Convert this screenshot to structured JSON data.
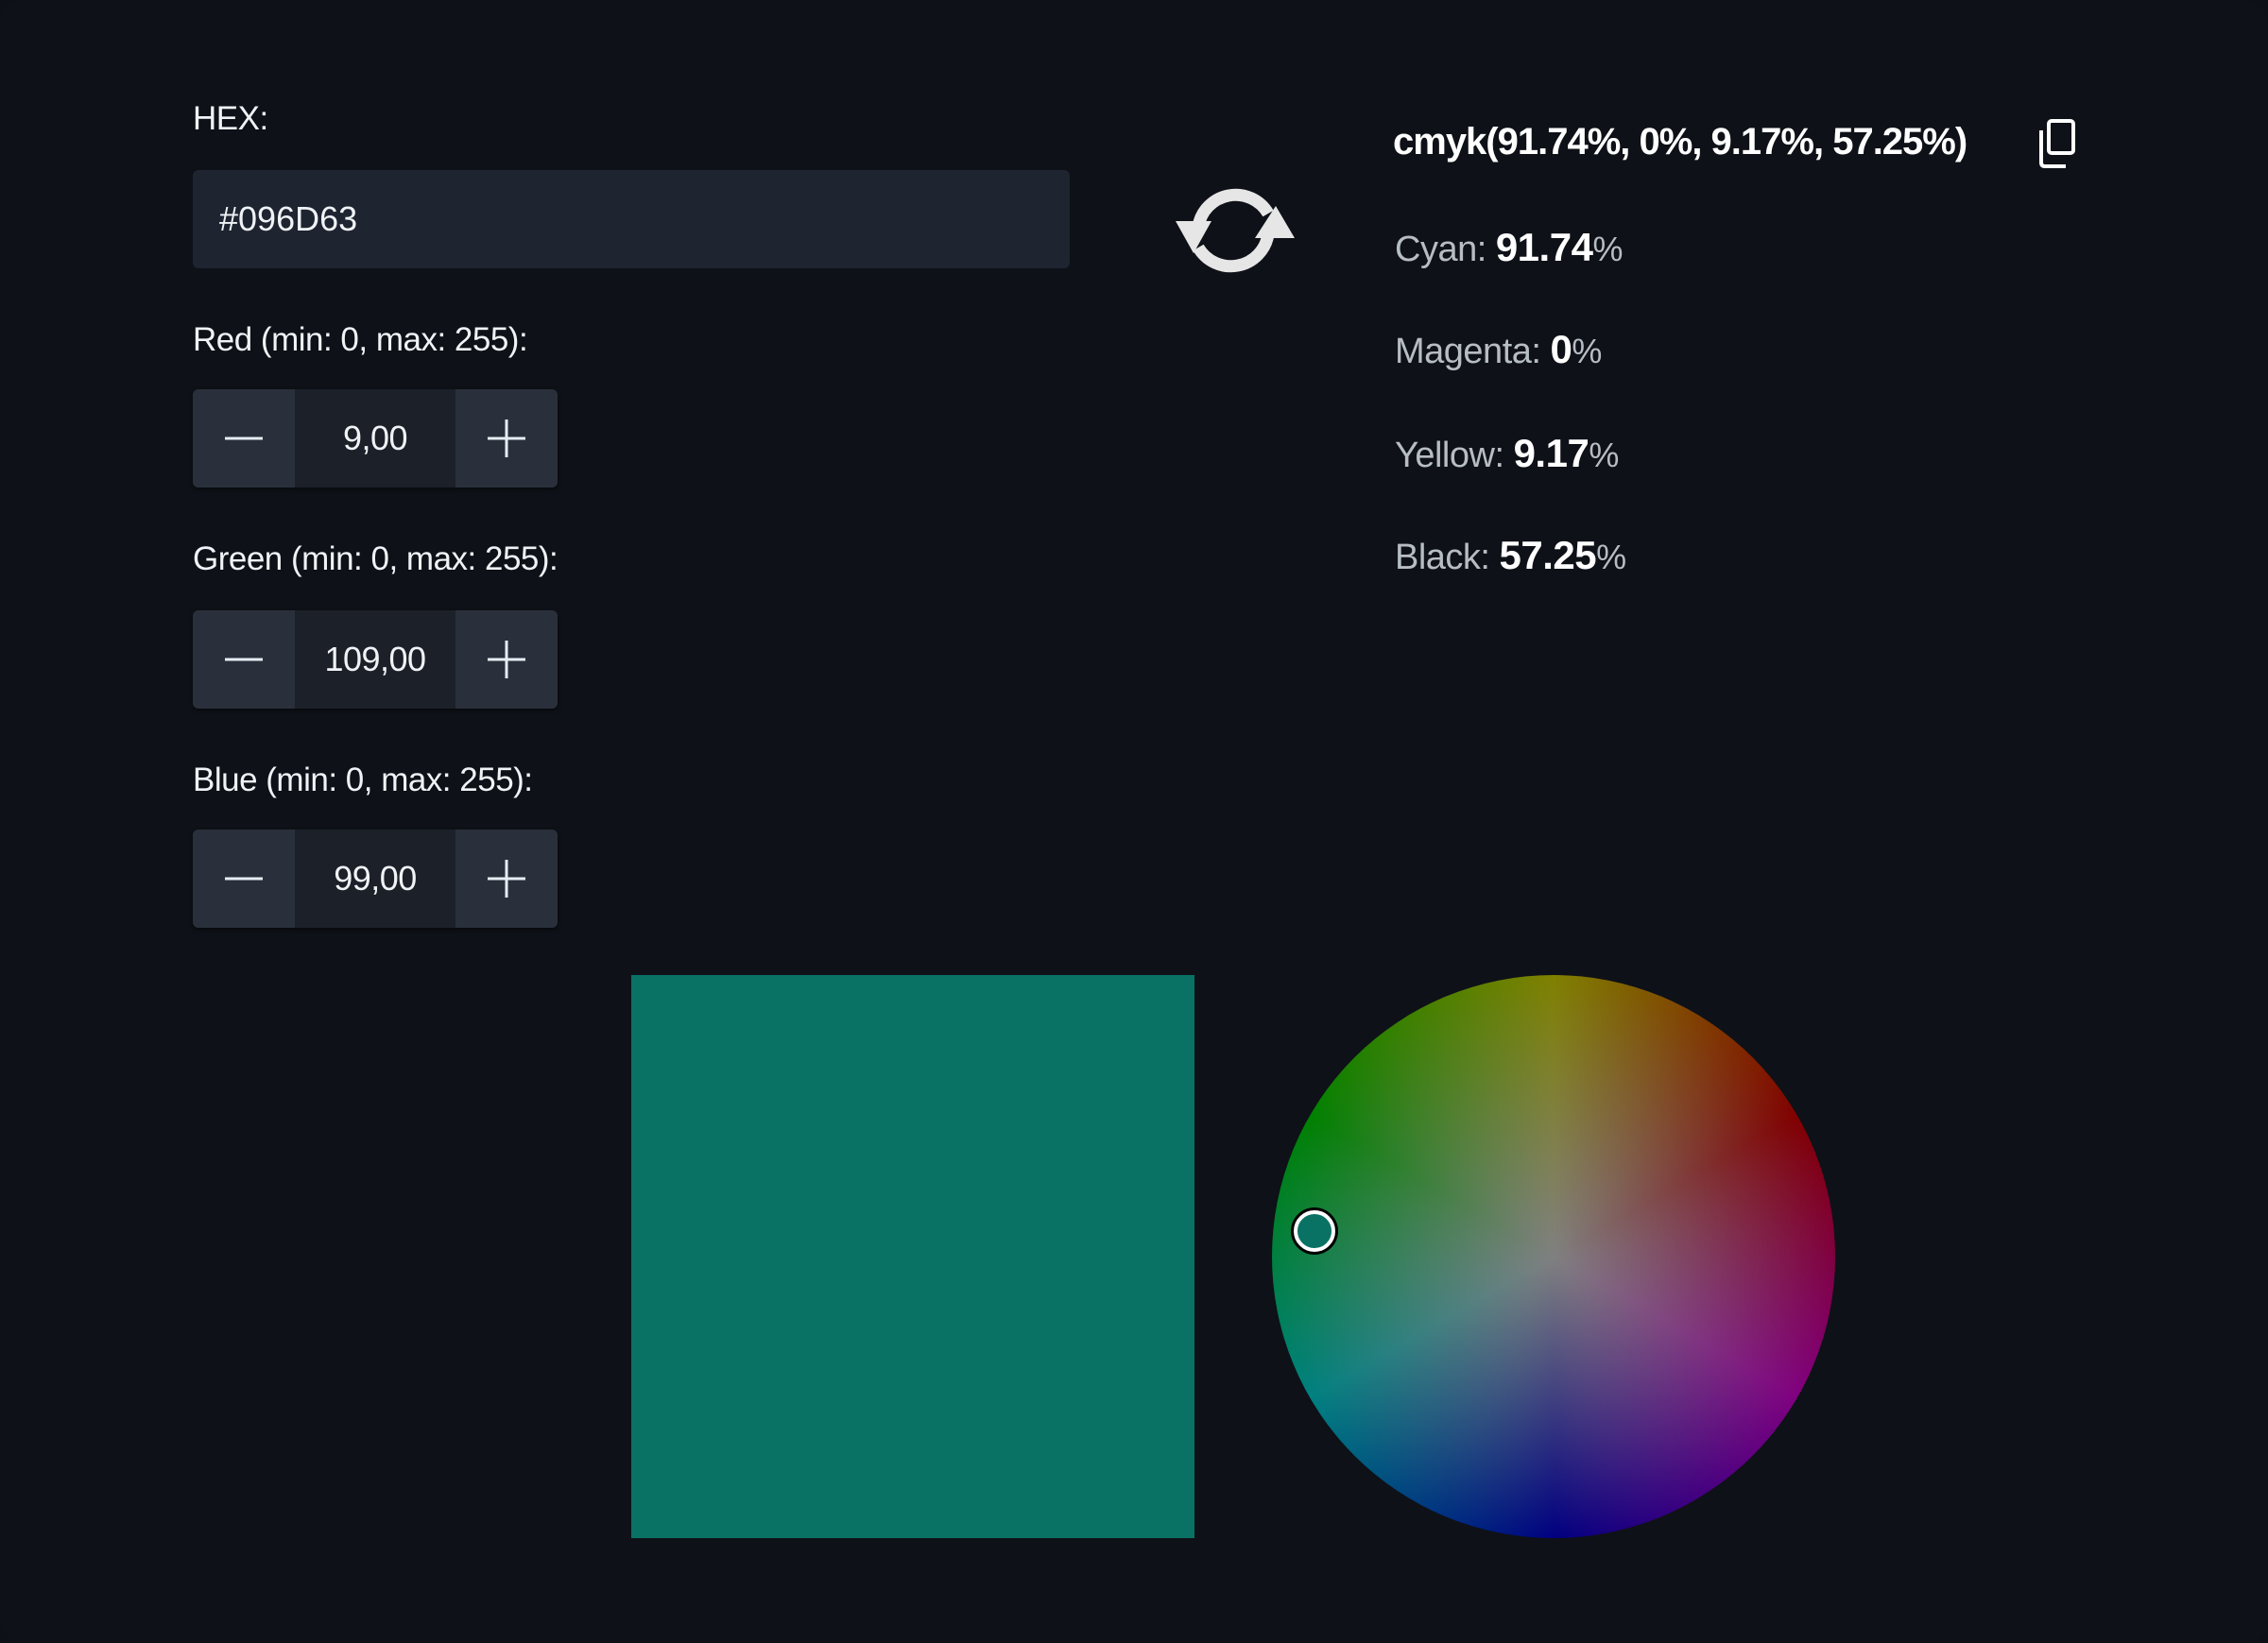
{
  "hex": {
    "label": "HEX:",
    "value": "#096D63"
  },
  "rgb": {
    "red": {
      "label": "Red (min: 0, max: 255):",
      "value": "9,00"
    },
    "green": {
      "label": "Green (min: 0, max: 255):",
      "value": "109,00"
    },
    "blue": {
      "label": "Blue (min: 0, max: 255):",
      "value": "99,00"
    }
  },
  "icons": {
    "sync": "sync-arrows-icon",
    "copy": "copy-icon",
    "minus": "minus-icon",
    "plus": "plus-icon"
  },
  "cmyk": {
    "string": "cmyk(91.74%, 0%, 9.17%, 57.25%)",
    "cyan": {
      "label": "Cyan: ",
      "value": "91.74",
      "unit": "%"
    },
    "magenta": {
      "label": "Magenta: ",
      "value": "0",
      "unit": "%"
    },
    "yellow": {
      "label": "Yellow: ",
      "value": "9.17",
      "unit": "%"
    },
    "black": {
      "label": "Black: ",
      "value": "57.25",
      "unit": "%"
    }
  },
  "colors": {
    "current": "#0A7265",
    "background": "#0E1117",
    "input_bg": "#1E2430"
  }
}
